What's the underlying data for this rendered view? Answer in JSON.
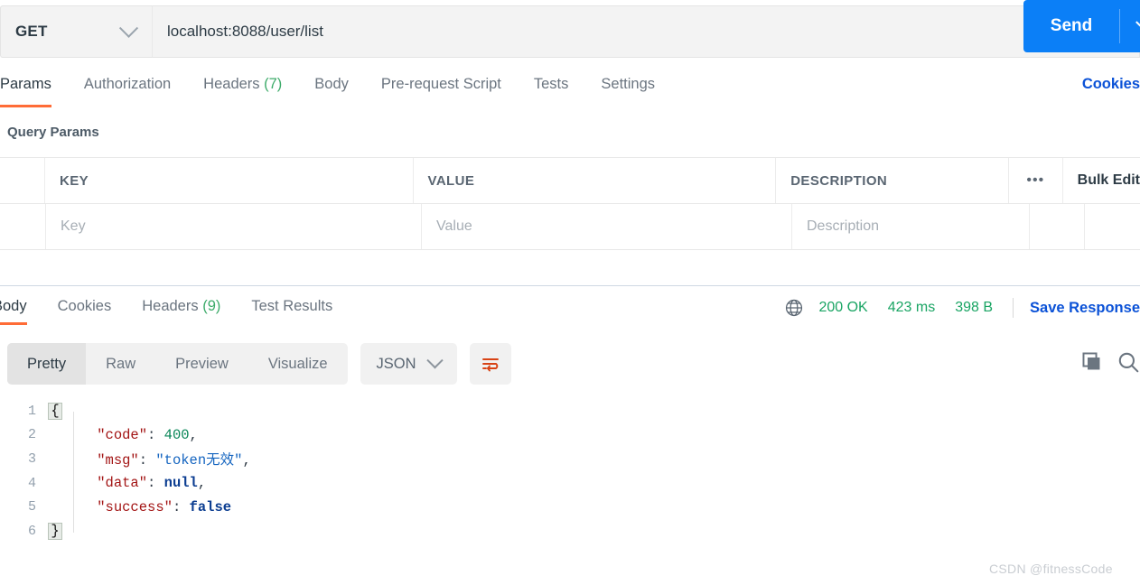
{
  "request": {
    "method": "GET",
    "url": "localhost:8088/user/list",
    "send_label": "Send",
    "cookies_link": "Cookies",
    "tabs": [
      {
        "label": "Params",
        "count": null,
        "active": true
      },
      {
        "label": "Authorization",
        "count": null,
        "active": false
      },
      {
        "label": "Headers",
        "count": "(7)",
        "active": false
      },
      {
        "label": "Body",
        "count": null,
        "active": false
      },
      {
        "label": "Pre-request Script",
        "count": null,
        "active": false
      },
      {
        "label": "Tests",
        "count": null,
        "active": false
      },
      {
        "label": "Settings",
        "count": null,
        "active": false
      }
    ]
  },
  "query_params": {
    "title": "Query Params",
    "columns": [
      "KEY",
      "VALUE",
      "DESCRIPTION"
    ],
    "more_icon": "•••",
    "bulk_edit_label": "Bulk Edit",
    "rows": [
      {
        "key_placeholder": "Key",
        "value_placeholder": "Value",
        "description_placeholder": "Description"
      }
    ]
  },
  "response": {
    "tabs": [
      {
        "label": "Body",
        "count": null,
        "active": true
      },
      {
        "label": "Cookies",
        "count": null,
        "active": false
      },
      {
        "label": "Headers",
        "count": "(9)",
        "active": false
      },
      {
        "label": "Test Results",
        "count": null,
        "active": false
      }
    ],
    "status_code": "200 OK",
    "time": "423 ms",
    "size": "398 B",
    "save_response_label": "Save Response",
    "view_modes": [
      {
        "label": "Pretty",
        "active": true
      },
      {
        "label": "Raw",
        "active": false
      },
      {
        "label": "Preview",
        "active": false
      },
      {
        "label": "Visualize",
        "active": false
      }
    ],
    "language": "JSON",
    "body_lines": [
      {
        "num": "1",
        "brace": "{",
        "text": ""
      },
      {
        "num": "2",
        "brace": "",
        "text": "    \"code\": 400,",
        "tokens": [
          {
            "t": "    ",
            "c": "p"
          },
          {
            "t": "\"code\"",
            "c": "k"
          },
          {
            "t": ": ",
            "c": "p"
          },
          {
            "t": "400",
            "c": "n"
          },
          {
            "t": ",",
            "c": "p"
          }
        ]
      },
      {
        "num": "3",
        "brace": "",
        "text": "    \"msg\": \"token无效\",",
        "tokens": [
          {
            "t": "    ",
            "c": "p"
          },
          {
            "t": "\"msg\"",
            "c": "k"
          },
          {
            "t": ": ",
            "c": "p"
          },
          {
            "t": "\"token无效\"",
            "c": "s"
          },
          {
            "t": ",",
            "c": "p"
          }
        ]
      },
      {
        "num": "4",
        "brace": "",
        "text": "    \"data\": null,",
        "tokens": [
          {
            "t": "    ",
            "c": "p"
          },
          {
            "t": "\"data\"",
            "c": "k"
          },
          {
            "t": ": ",
            "c": "p"
          },
          {
            "t": "null",
            "c": "lit"
          },
          {
            "t": ",",
            "c": "p"
          }
        ]
      },
      {
        "num": "5",
        "brace": "",
        "text": "    \"success\": false",
        "tokens": [
          {
            "t": "    ",
            "c": "p"
          },
          {
            "t": "\"success\"",
            "c": "k"
          },
          {
            "t": ": ",
            "c": "p"
          },
          {
            "t": "false",
            "c": "lit"
          }
        ]
      },
      {
        "num": "6",
        "brace": "}",
        "text": ""
      }
    ]
  },
  "watermark": "CSDN @fitnessCode",
  "colors": {
    "accent_orange": "#ff6c37",
    "send_blue": "#0b7ff7",
    "link_blue": "#0b52d7",
    "status_green": "#19a463"
  }
}
